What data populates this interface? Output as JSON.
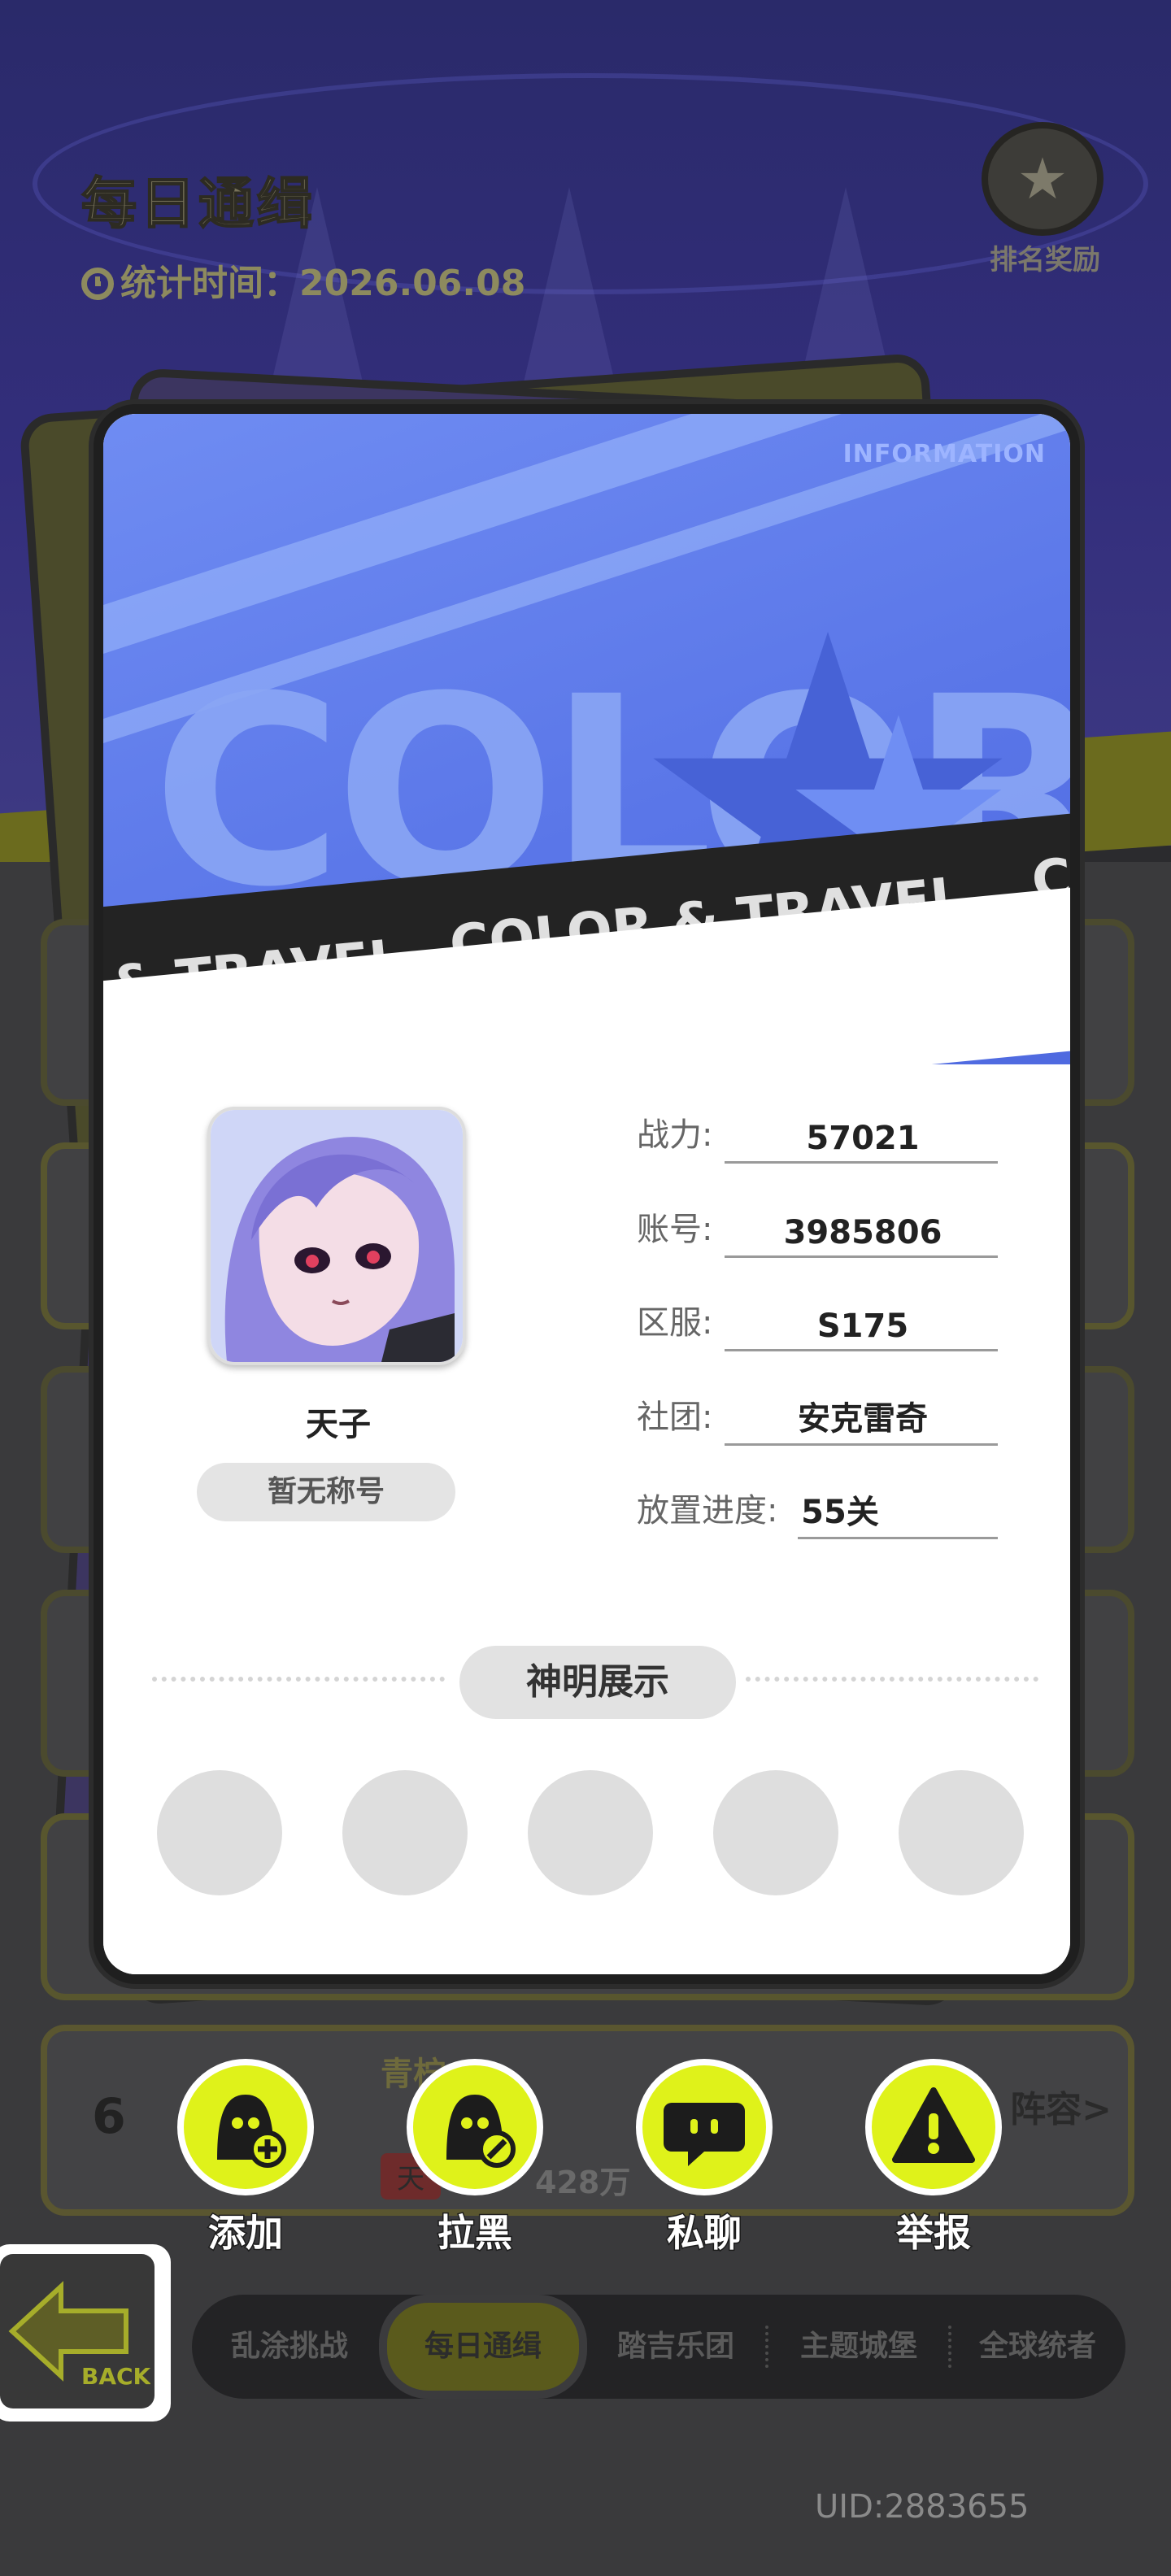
{
  "background": {
    "title": "每日通缉",
    "stat_time_label": "统计时间：",
    "stat_time_value": "2026.06.08",
    "rank_reward_label": "排名奖励",
    "row6": {
      "rank": "6",
      "name": "青柠",
      "tag": "天",
      "value": "428万",
      "right_label": "阵容>"
    }
  },
  "card": {
    "banner": {
      "info_text": "INFORMATION",
      "big_text": "COLOR",
      "band_text_left": "& TRAVEL",
      "band_text_center": "COLOR & TRAVEL",
      "band_text_right": "CO"
    },
    "player": {
      "nickname": "天子",
      "title": "暂无称号"
    },
    "fields": [
      {
        "label": "战力:",
        "value": "57021"
      },
      {
        "label": "账号:",
        "value": "3985806"
      },
      {
        "label": "区服:",
        "value": "S175"
      },
      {
        "label": "社团:",
        "value": "安克雷奇"
      },
      {
        "label": "放置进度:",
        "value": "55关"
      }
    ],
    "deity_section_title": "神明展示",
    "deity_slots": 5
  },
  "actions": [
    {
      "label": "添加",
      "icon": "add-friend-icon"
    },
    {
      "label": "拉黑",
      "icon": "block-user-icon"
    },
    {
      "label": "私聊",
      "icon": "chat-bubble-icon"
    },
    {
      "label": "举报",
      "icon": "warning-icon"
    }
  ],
  "back_label": "BACK",
  "tabs": [
    "乱涂挑战",
    "每日通缉",
    "踏吉乐团",
    "主题城堡",
    "全球统者"
  ],
  "active_tab": "每日通缉",
  "uid": "UID:2883655",
  "colors": {
    "accent_yellow": "#dff21a",
    "banner_blue": "#5a76e8",
    "card_border": "#1f1f1f"
  }
}
